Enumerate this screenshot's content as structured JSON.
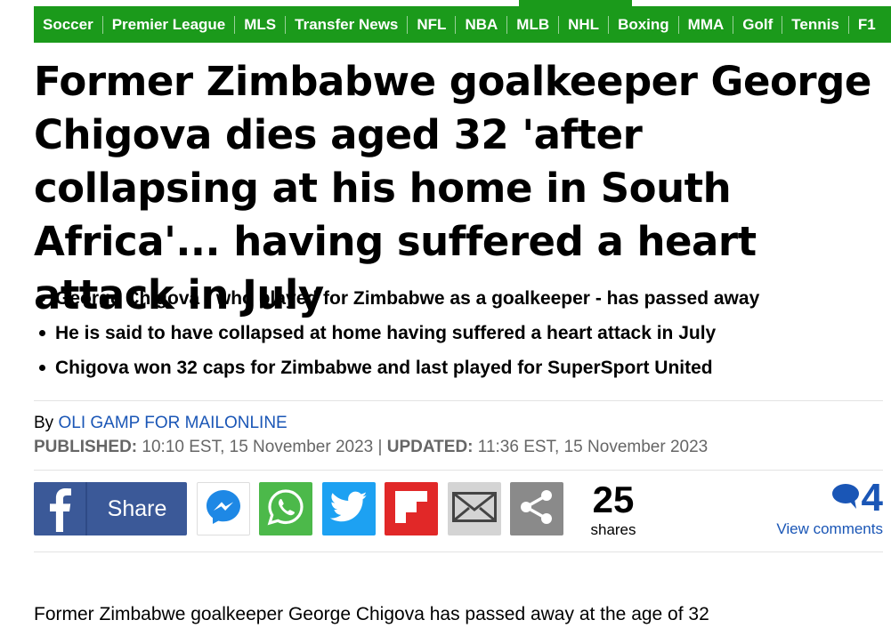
{
  "nav": {
    "active_index": 7,
    "items": [
      "Soccer",
      "Premier League",
      "MLS",
      "Transfer News",
      "NFL",
      "NBA",
      "MLB",
      "NHL",
      "Boxing",
      "MMA",
      "Golf",
      "Tennis",
      "F1"
    ]
  },
  "article": {
    "headline": "Former Zimbabwe goalkeeper George Chigova dies aged 32 'after collapsing at his home in South Africa'... having suffered a heart attack in July",
    "bullets": [
      "George Chigova - who played for Zimbabwe as a goalkeeper - has passed away",
      "He is said to have collapsed at home having suffered a heart attack in July",
      "Chigova won 32 caps for Zimbabwe and last played for SuperSport United"
    ],
    "byline_prefix": "By",
    "author": "OLI GAMP FOR MAILONLINE",
    "published_label": "PUBLISHED:",
    "published_value": "10:10 EST, 15 November 2023",
    "separator": "|",
    "updated_label": "UPDATED:",
    "updated_value": "11:36 EST, 15 November 2023",
    "body_first_line": "Former Zimbabwe goalkeeper George Chigova has passed away at the age of 32"
  },
  "share": {
    "facebook_label": "Share",
    "count": "25",
    "count_label": "shares",
    "comments_count": "4",
    "comments_link": "View comments",
    "buttons": [
      {
        "name": "messenger-icon",
        "color": "#ffffff"
      },
      {
        "name": "whatsapp-icon",
        "color": "#4cb94a"
      },
      {
        "name": "twitter-icon",
        "color": "#1da1f2"
      },
      {
        "name": "flipboard-icon",
        "color": "#e12828"
      },
      {
        "name": "email-icon",
        "color": "#d4d4d4"
      },
      {
        "name": "share-more-icon",
        "color": "#8a8a8a"
      }
    ]
  },
  "colors": {
    "nav_green": "#1b9a1b",
    "link_blue": "#1a56b6",
    "facebook_blue": "#3b5998"
  }
}
